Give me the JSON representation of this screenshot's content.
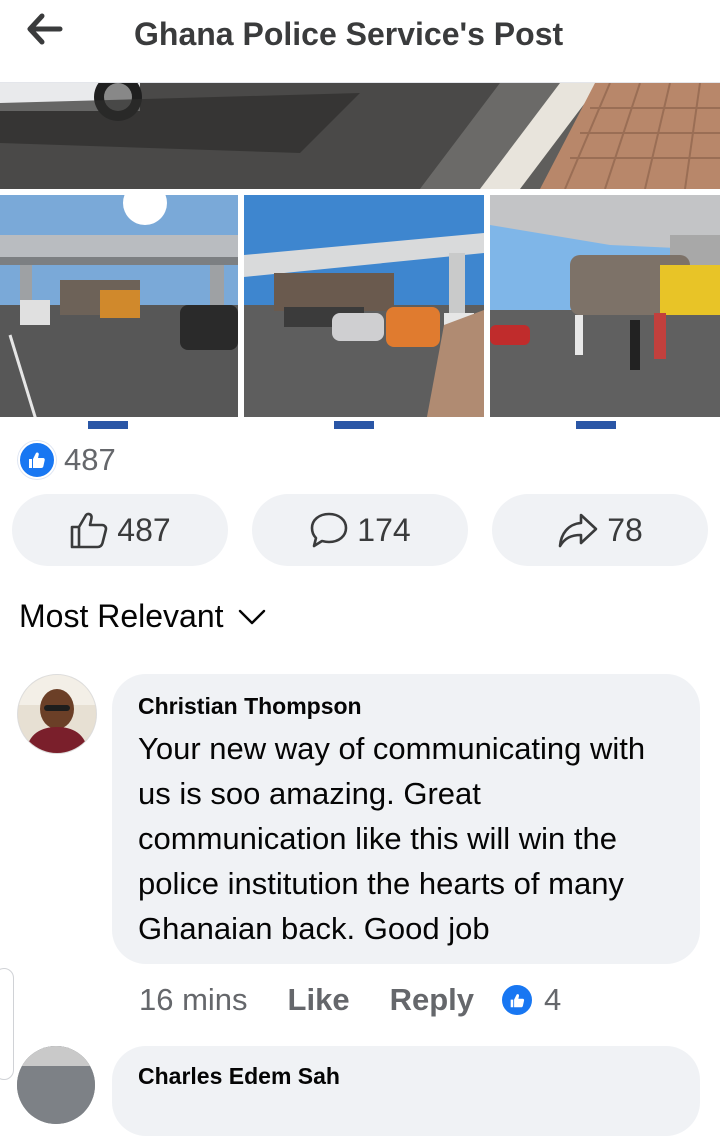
{
  "header": {
    "title": "Ghana Police Service's Post",
    "back_icon": "arrow-left-icon"
  },
  "reactions": {
    "icon": "thumbs-up-icon",
    "count": "487"
  },
  "actions": {
    "like": {
      "icon": "thumbs-up-outline-icon",
      "count": "487"
    },
    "comment": {
      "icon": "comment-icon",
      "count": "174"
    },
    "share": {
      "icon": "share-arrow-icon",
      "count": "78"
    }
  },
  "sort": {
    "label": "Most Relevant",
    "icon": "chevron-down-icon"
  },
  "comments": [
    {
      "author": "Christian Thompson",
      "text": "Your new way of communicating with us is soo amazing. Great communication like this will win the police institution the hearts of many Ghanaian back. Good job",
      "time": "16 mins",
      "like_label": "Like",
      "reply_label": "Reply",
      "reaction_count": "4"
    },
    {
      "author": "Charles Edem Sah"
    }
  ],
  "colors": {
    "accent": "#1877f2",
    "bubble": "#f0f2f5",
    "muted": "#65676b"
  }
}
